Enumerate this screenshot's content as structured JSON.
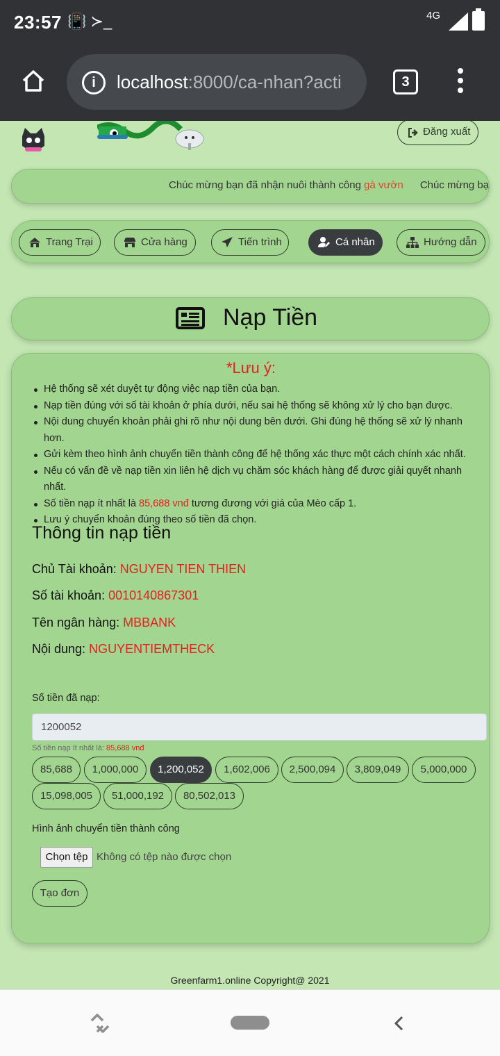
{
  "status_bar": {
    "time": "23:57",
    "notif_icons": "📳 ≻_",
    "network": "4G"
  },
  "browser": {
    "url_host": "localhost",
    "url_rest": ":8000/ca-nhan?acti",
    "tab_count": "3"
  },
  "header": {
    "logout_label": "Đăng xuất"
  },
  "ticker": {
    "text_before": "Chúc mừng bạn đã nhận nuôi thành công ",
    "highlight": "gà vườn",
    "text_after": "Chúc mừng bạn"
  },
  "nav": {
    "items": [
      {
        "label": "Trang Trại",
        "icon": "home-icon"
      },
      {
        "label": "Cửa hàng",
        "icon": "store-icon"
      },
      {
        "label": "Tiến trình",
        "icon": "send-icon"
      },
      {
        "label": "Cá nhân",
        "icon": "user-edit-icon",
        "active": true
      },
      {
        "label": "Hướng dẫn",
        "icon": "sitemap-icon"
      }
    ]
  },
  "page_title": "Nạp Tiền",
  "notes": {
    "title": "*Lưu ý:",
    "items": [
      "Hệ thống sẽ xét duyệt tự động việc nạp tiền của bạn.",
      "Nạp tiền đúng với số tài khoản ở phía dưới, nếu sai hệ thống sẽ không xử lý cho bạn được.",
      "Nội dung chuyển khoản phải ghi rõ như nội dung bên dưới. Ghi đúng hệ thống sẽ xử lý nhanh hơn.",
      "Gửi kèm theo hình ảnh chuyển tiền thành công để hệ thống xác thực một cách chính xác nhất.",
      "Nếu có vấn đề về nạp tiền xin liên hệ dịch vụ chăm sóc khách hàng để được giải quyết nhanh nhất.",
      "Lưu ý chuyển khoản đúng theo số tiền đã chọn."
    ],
    "min_prefix": "Số tiền nạp ít nhất là ",
    "min_value": "85,688 vnđ",
    "min_suffix": " tương đương với giá của Mèo cấp 1."
  },
  "deposit_info": {
    "heading": "Thông tin nạp tiền",
    "owner_label": "Chủ Tài khoản: ",
    "owner_value": "NGUYEN TIEN THIEN",
    "account_label": "Số tài khoản: ",
    "account_value": "0010140867301",
    "bank_label": "Tên ngân hàng: ",
    "bank_value": "MBBANK",
    "content_label": "Nội dung: ",
    "content_value": "NGUYENTIEMTHECK"
  },
  "form": {
    "amount_label": "Số tiền đã nạp:",
    "amount_value": "1200052",
    "hint_prefix": "Số tiền nạp ít nhất là: ",
    "hint_value": "85,688 vnđ",
    "amounts": [
      "85,688",
      "1,000,000",
      "1,200,052",
      "1,602,006",
      "2,500,094",
      "3,809,049",
      "5,000,000",
      "15,098,005",
      "51,000,192",
      "80,502,013"
    ],
    "selected_amount": "1,200,052",
    "image_label": "Hình ảnh chuyển tiền thành công",
    "file_button": "Chọn tệp",
    "file_status": "Không có tệp nào được chọn",
    "submit_label": "Tạo đơn"
  },
  "footer": "Greenfarm1.online Copyright@ 2021"
}
